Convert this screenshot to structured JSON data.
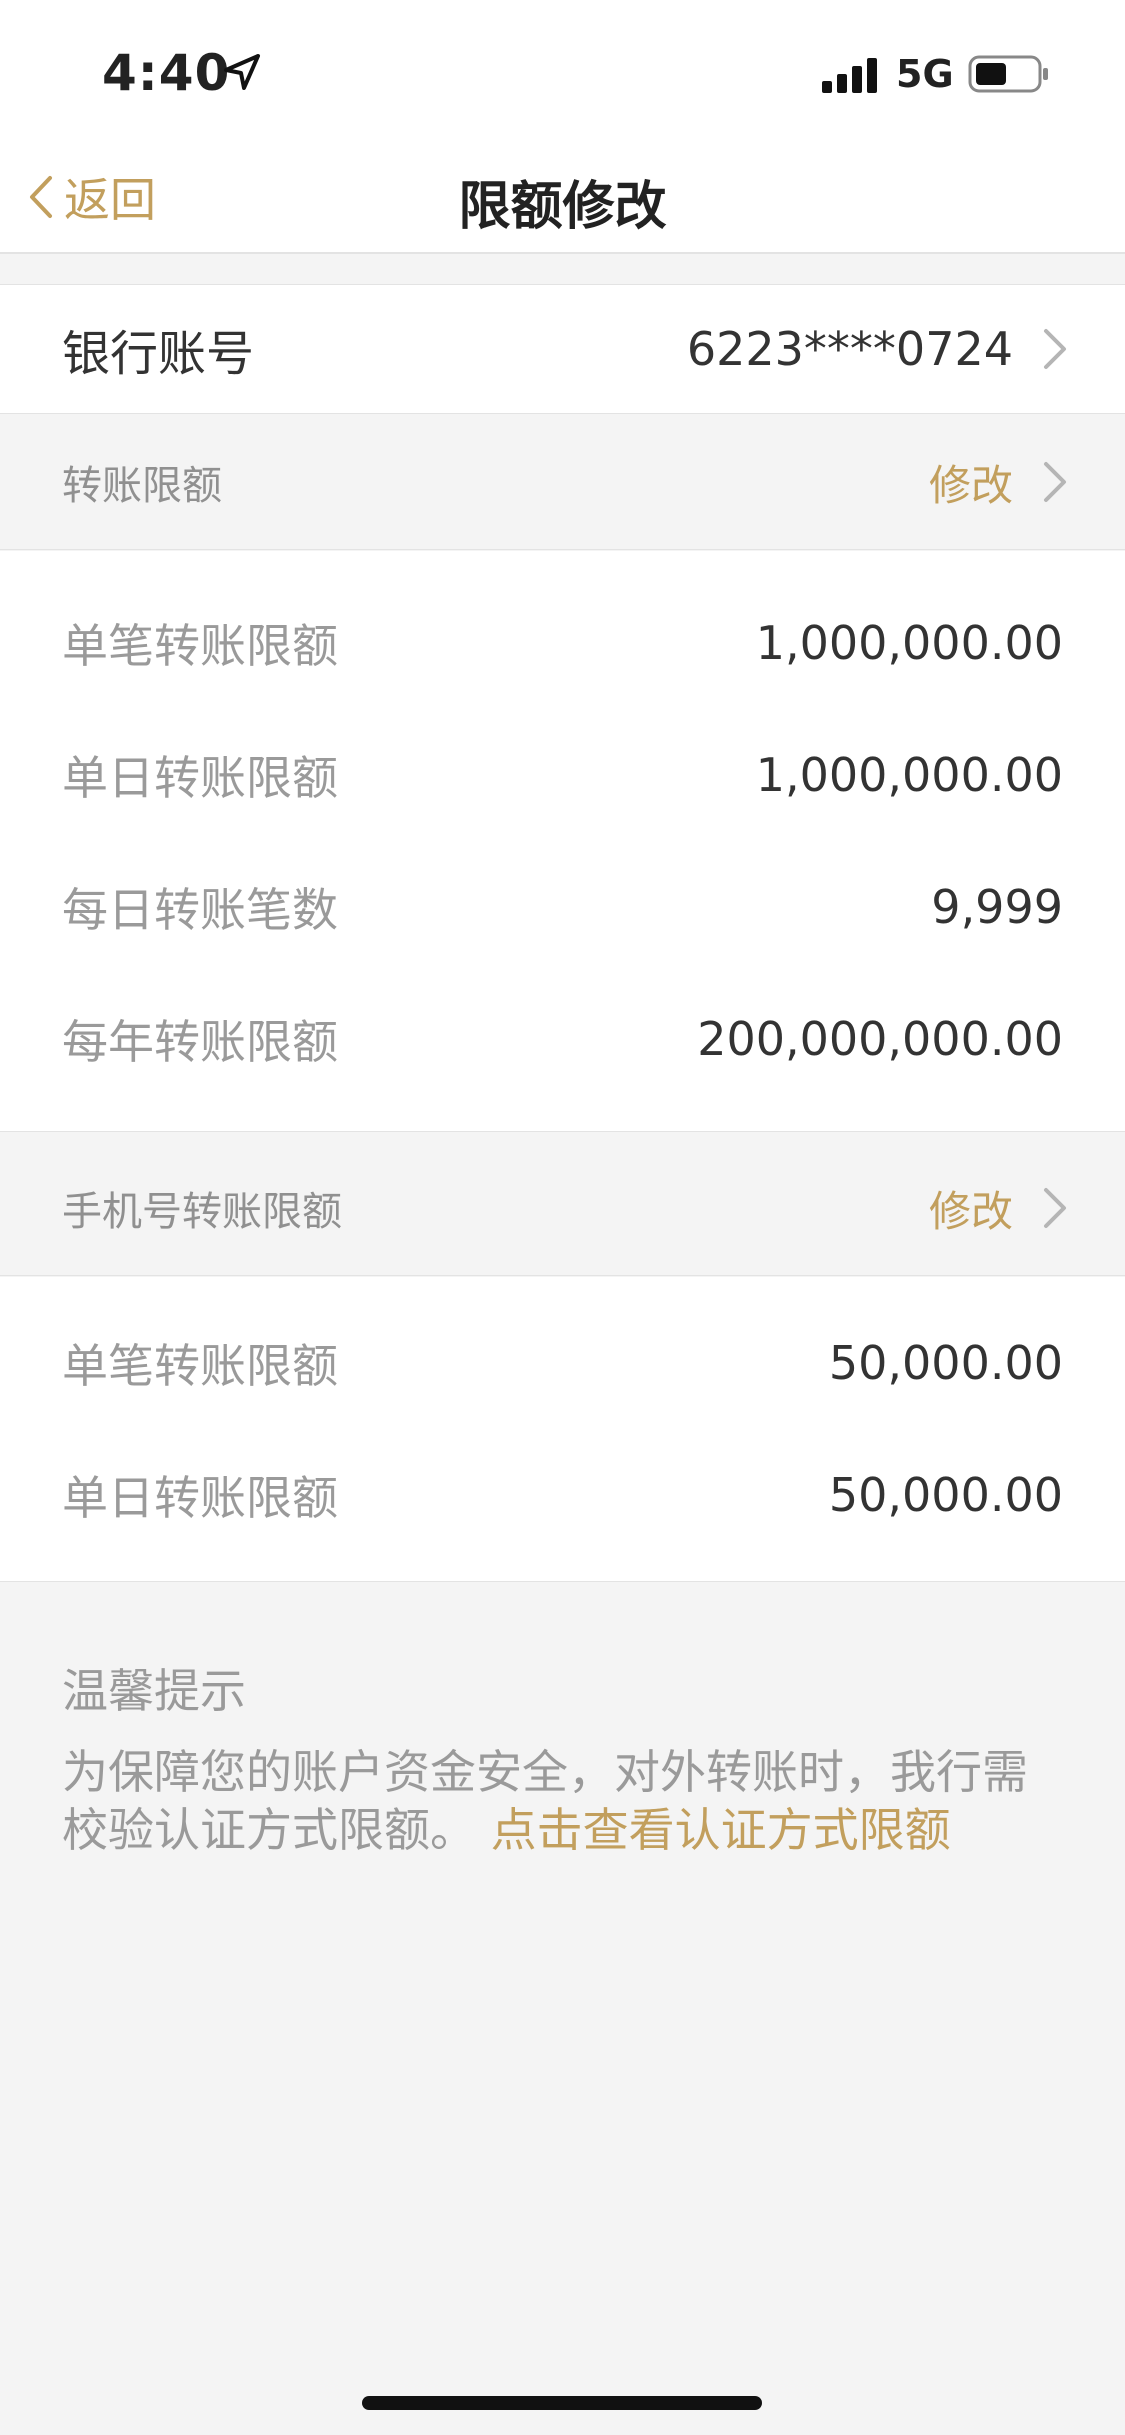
{
  "status_bar": {
    "time": "4:40",
    "network": "5G"
  },
  "nav": {
    "back_label": "返回",
    "title": "限额修改"
  },
  "account": {
    "label": "银行账号",
    "value": "6223****0724"
  },
  "transfer_section": {
    "label": "转账限额",
    "action": "修改",
    "items": [
      {
        "label": "单笔转账限额",
        "value": "1,000,000.00"
      },
      {
        "label": "单日转账限额",
        "value": "1,000,000.00"
      },
      {
        "label": "每日转账笔数",
        "value": "9,999"
      },
      {
        "label": "每年转账限额",
        "value": "200,000,000.00"
      }
    ]
  },
  "phone_section": {
    "label": "手机号转账限额",
    "action": "修改",
    "items": [
      {
        "label": "单笔转账限额",
        "value": "50,000.00"
      },
      {
        "label": "单日转账限额",
        "value": "50,000.00"
      }
    ]
  },
  "tips": {
    "title": "温馨提示",
    "text": "为保障您的账户资金安全，对外转账时，我行需校验认证方式限额。",
    "link": "点击查看认证方式限额"
  },
  "colors": {
    "accent": "#c29f5d",
    "background": "#f4f4f4",
    "card": "#ffffff"
  }
}
